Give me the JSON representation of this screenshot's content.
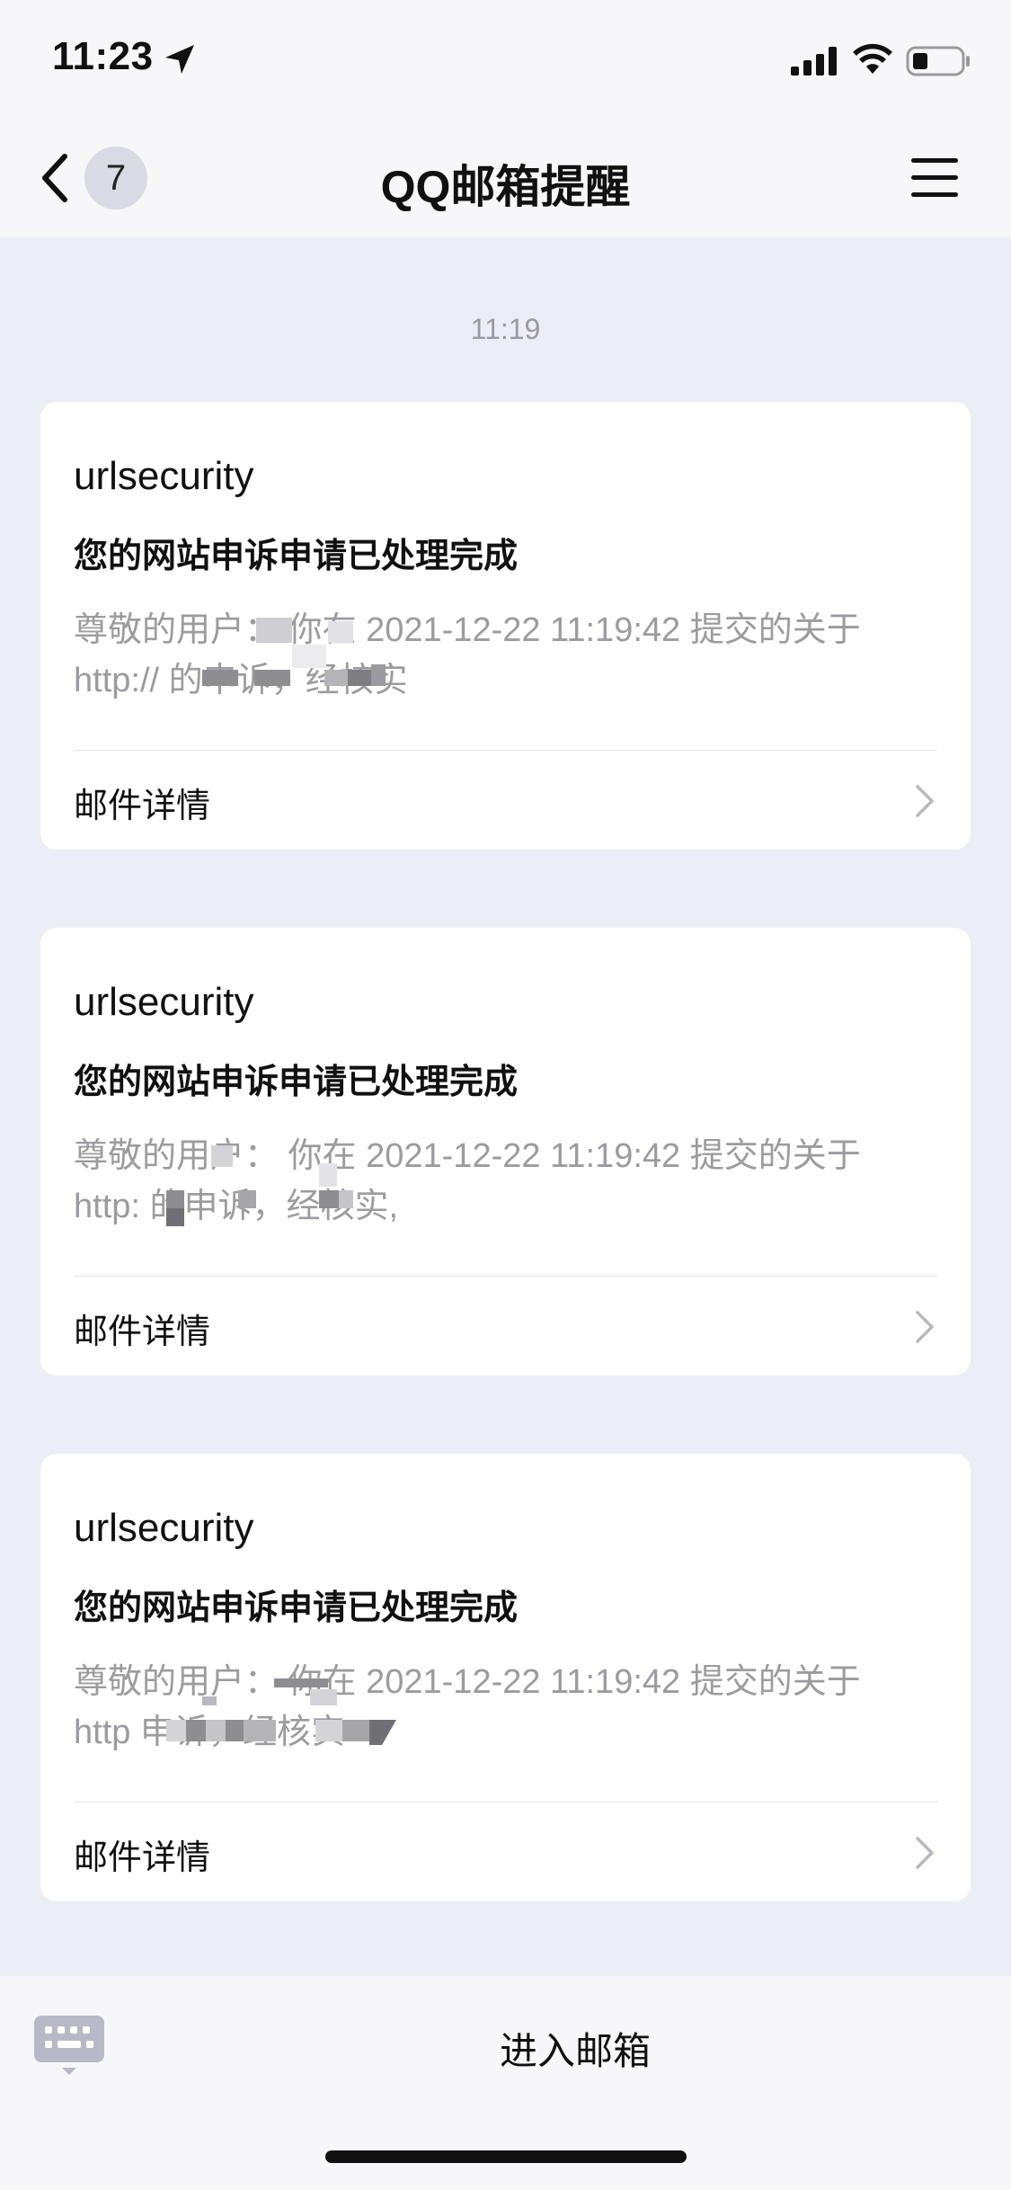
{
  "status_bar": {
    "time": "11:23",
    "icons": [
      "location-arrow-icon",
      "cellular-signal-icon",
      "wifi-icon",
      "battery-icon"
    ]
  },
  "nav": {
    "unread_count": "7",
    "title": "QQ邮箱提醒",
    "back_icon": "chevron-left-icon",
    "menu_icon": "hamburger-menu-icon"
  },
  "timestamp": "11:19",
  "messages": [
    {
      "sender": "urlsecurity",
      "subject": "您的网站申诉申请已处理完成",
      "preview_line1": "尊敬的用户：  你在 2021-12-22 11:19:42 提交的关于",
      "preview_line2": "http://                      的申诉，经核实",
      "details_label": "邮件详情"
    },
    {
      "sender": "urlsecurity",
      "subject": "您的网站申诉申请已处理完成",
      "preview_line1": "尊敬的用户：  你在 2021-12-22 11:19:42 提交的关于",
      "preview_line2": "http:                   的申诉，经核实,",
      "details_label": "邮件详情"
    },
    {
      "sender": "urlsecurity",
      "subject": "您的网站申诉申请已处理完成",
      "preview_line1": "尊敬的用户：  你在 2021-12-22 11:19:42 提交的关于",
      "preview_line2": "http                        申诉，经核实",
      "details_label": "邮件详情"
    }
  ],
  "bottom_bar": {
    "keyboard_icon": "keyboard-icon",
    "enter_mailbox_label": "进入邮箱"
  },
  "colors": {
    "background": "#eceef5",
    "card": "#ffffff",
    "secondary_text": "#9b9ba0",
    "badge": "#d9dae2"
  }
}
